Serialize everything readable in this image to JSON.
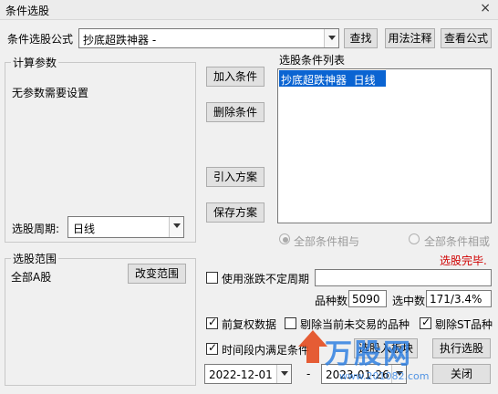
{
  "window": {
    "title": "条件选股",
    "close_glyph": "×"
  },
  "formula": {
    "label": "条件选股公式",
    "value": "抄底超跌神器 -",
    "find_button": "查找",
    "usage_button": "用法注释",
    "view_button": "查看公式"
  },
  "params": {
    "group_title": "计算参数",
    "no_params_text": "无参数需要设置",
    "period_label": "选股周期:",
    "period_value": "日线"
  },
  "actions": {
    "add_condition": "加入条件",
    "delete_condition": "删除条件",
    "import_plan": "引入方案",
    "save_plan": "保存方案"
  },
  "conditions": {
    "list_title": "选股条件列表",
    "items": [
      "抄底超跌神器  日线"
    ],
    "radio_and": "全部条件相与",
    "radio_or": "全部条件相或"
  },
  "status": {
    "text": "选股完毕.",
    "color": "#d00000"
  },
  "range": {
    "group_title": "选股范围",
    "value": "全部A股",
    "change_button": "改变范围"
  },
  "options": {
    "use_variable_period": "使用涨跌不定周期",
    "variable_period_value": "",
    "stock_count_label": "品种数",
    "stock_count_value": "5090",
    "selected_label": "选中数",
    "selected_value": "171/3.4%",
    "forward_adjust": "前复权数据",
    "exclude_untraded": "剔除当前未交易的品种",
    "exclude_st": "剔除ST品种",
    "period_satisfy": "时间段内满足条件",
    "start_date": "2022-12-01",
    "end_date": "2023-01-26",
    "date_separator": "-"
  },
  "footer": {
    "add_to_block_button": "选股入板块",
    "execute_button": "执行选股",
    "close_button": "关闭"
  },
  "watermark": {
    "text": "万股网",
    "url": "www.201082.com"
  }
}
